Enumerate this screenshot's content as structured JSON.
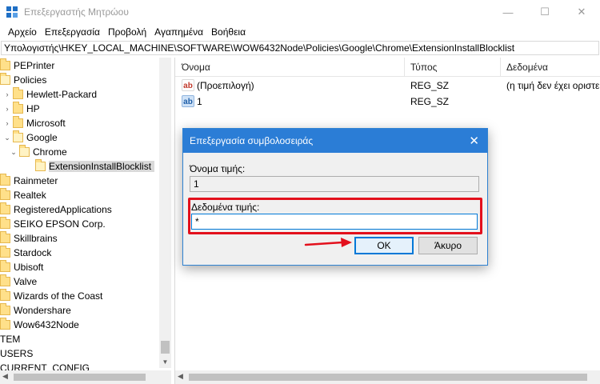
{
  "window": {
    "title": "Επεξεργαστής Μητρώου",
    "min_glyph": "—",
    "max_glyph": "☐",
    "close_glyph": "✕"
  },
  "menu": [
    "Αρχείο",
    "Επεξεργασία",
    "Προβολή",
    "Αγαπημένα",
    "Βοήθεια"
  ],
  "address": "Υπολογιστής\\HKEY_LOCAL_MACHINE\\SOFTWARE\\WOW6432Node\\Policies\\Google\\Chrome\\ExtensionInstallBlocklist",
  "tree": {
    "items": [
      {
        "label": "PEPrinter"
      },
      {
        "label": "Policies"
      },
      {
        "label": "Hewlett-Packard"
      },
      {
        "label": "HP"
      },
      {
        "label": "Microsoft"
      },
      {
        "label": "Google"
      },
      {
        "label": "Chrome"
      },
      {
        "label": "ExtensionInstallBlocklist"
      },
      {
        "label": "Rainmeter"
      },
      {
        "label": "Realtek"
      },
      {
        "label": "RegisteredApplications"
      },
      {
        "label": "SEIKO EPSON Corp."
      },
      {
        "label": "Skillbrains"
      },
      {
        "label": "Stardock"
      },
      {
        "label": "Ubisoft"
      },
      {
        "label": "Valve"
      },
      {
        "label": "Wizards of the Coast"
      },
      {
        "label": "Wondershare"
      },
      {
        "label": "Wow6432Node"
      },
      {
        "label": "TEM"
      },
      {
        "label": "USERS"
      },
      {
        "label": "CURRENT_CONFIG"
      }
    ]
  },
  "list": {
    "columns": [
      "Όνομα",
      "Τύπος",
      "Δεδομένα"
    ],
    "rows": [
      {
        "icon": "ab",
        "name": "(Προεπιλογή)",
        "type": "REG_SZ",
        "data": "(η τιμή δεν έχει οριστεί)"
      },
      {
        "icon": "ab",
        "name": "1",
        "type": "REG_SZ",
        "data": ""
      }
    ]
  },
  "dialog": {
    "title": "Επεξεργασία συμβολοσειράς",
    "close_glyph": "✕",
    "value_name_label": "Όνομα τιμής:",
    "value_name": "1",
    "value_data_label": "Δεδομένα τιμής:",
    "value_data": "*",
    "ok_label": "OK",
    "cancel_label": "Άκυρο"
  },
  "colors": {
    "accent": "#2b7dd6",
    "highlight": "#e3101c",
    "folder": "#ffe08a"
  }
}
